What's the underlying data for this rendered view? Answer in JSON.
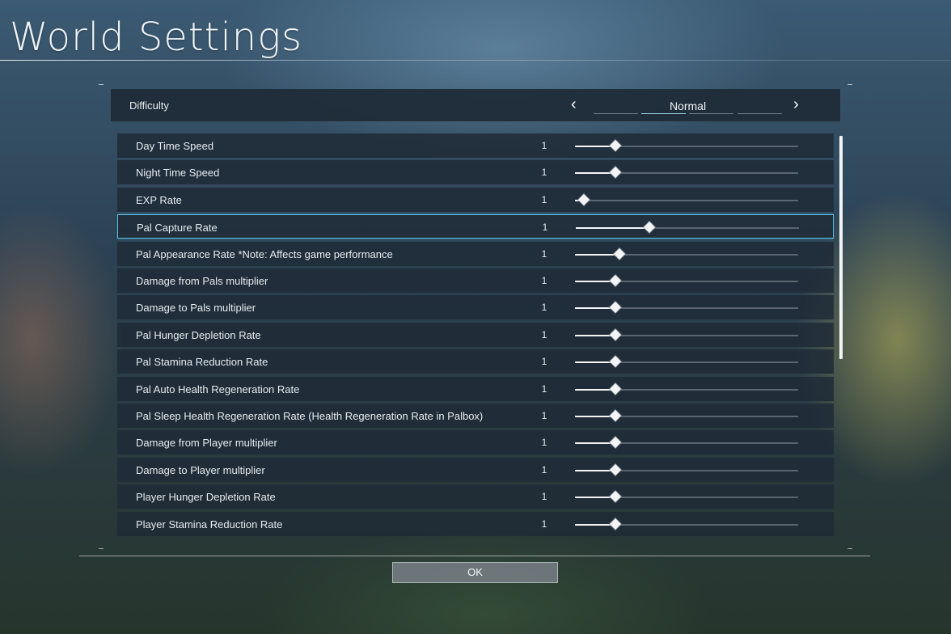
{
  "screen": {
    "title": "World Settings"
  },
  "difficulty": {
    "label": "Difficulty",
    "value": "Normal",
    "left_arrow": "‹",
    "right_arrow": "›"
  },
  "settings": [
    {
      "label": "Day Time Speed",
      "value": "1",
      "fraction": 0.18
    },
    {
      "label": "Night Time Speed",
      "value": "1",
      "fraction": 0.18
    },
    {
      "label": "EXP Rate",
      "value": "1",
      "fraction": 0.04
    },
    {
      "label": "Pal Capture Rate",
      "value": "1",
      "fraction": 0.33,
      "selected": true
    },
    {
      "label": "Pal Appearance Rate *Note: Affects game performance",
      "value": "1",
      "fraction": 0.2
    },
    {
      "label": "Damage from Pals multiplier",
      "value": "1",
      "fraction": 0.18
    },
    {
      "label": "Damage to Pals multiplier",
      "value": "1",
      "fraction": 0.18
    },
    {
      "label": "Pal Hunger Depletion Rate",
      "value": "1",
      "fraction": 0.18
    },
    {
      "label": "Pal Stamina Reduction Rate",
      "value": "1",
      "fraction": 0.18
    },
    {
      "label": "Pal Auto Health Regeneration Rate",
      "value": "1",
      "fraction": 0.18
    },
    {
      "label": "Pal Sleep Health Regeneration Rate (Health Regeneration Rate in Palbox)",
      "value": "1",
      "fraction": 0.18
    },
    {
      "label": "Damage from Player multiplier",
      "value": "1",
      "fraction": 0.18
    },
    {
      "label": "Damage to Player multiplier",
      "value": "1",
      "fraction": 0.18
    },
    {
      "label": "Player Hunger Depletion Rate",
      "value": "1",
      "fraction": 0.18
    },
    {
      "label": "Player Stamina Reduction Rate",
      "value": "1",
      "fraction": 0.18
    }
  ],
  "footer": {
    "ok_label": "OK"
  },
  "colors": {
    "accent": "#59c3e6",
    "panel": "#1e2a36"
  }
}
